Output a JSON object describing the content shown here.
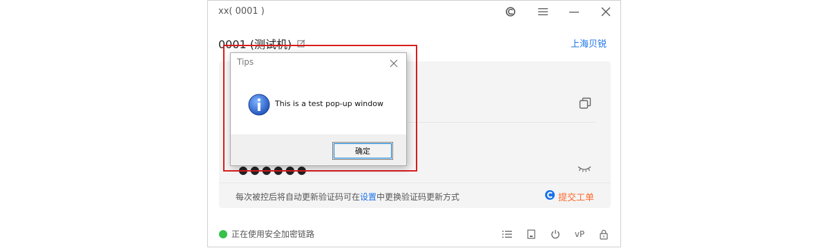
{
  "window": {
    "title": "xx( 0001 )",
    "device_name": "0001 (测试机)",
    "org_link": "上海贝锐"
  },
  "panel": {
    "password_mask": "●●●●●●",
    "notice_prefix": "每次被控后将自动更新验证码可在",
    "notice_link": "设置",
    "notice_suffix": "中更换验证码更新方式",
    "ticket_label": "提交工单"
  },
  "status": {
    "text": "正在使用安全加密链路",
    "color": "#35c14a"
  },
  "bottom_bar": {
    "vp_label": "vP"
  },
  "dialog": {
    "title": "Tips",
    "message": "This is a test pop-up window",
    "ok_label": "确定"
  },
  "colors": {
    "highlight": "#d91a1a",
    "link": "#1a73e8",
    "ticket": "#ff6a2a"
  }
}
